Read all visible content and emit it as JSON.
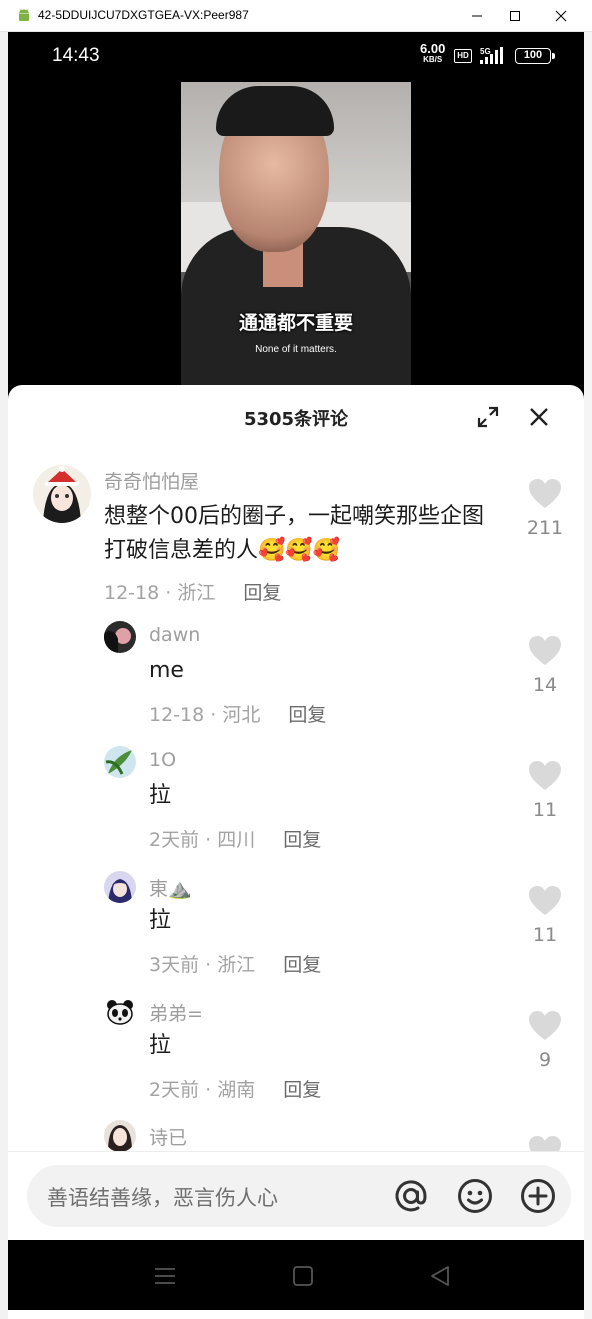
{
  "window": {
    "title": "42-5DDUIJCU7DXGTGEA-VX:Peer987"
  },
  "status": {
    "time": "14:43",
    "speed_value": "6.00",
    "speed_unit": "KB/S",
    "hd": "HD",
    "network": "5G",
    "battery": "100"
  },
  "video": {
    "subtitle_zh": "通通都不重要",
    "subtitle_en": "None of it matters."
  },
  "comments_panel": {
    "title": "5305条评论",
    "comments": [
      {
        "user": "奇奇怕怕屋",
        "text": "想整个00后的圈子，一起嘲笑那些企图打破信息差的人🥰🥰🥰",
        "date": "12-18 · 浙江",
        "reply": "回复",
        "likes": "211"
      },
      {
        "user": "dawn",
        "text": "me",
        "date": "12-18 · 河北",
        "reply": "回复",
        "likes": "14"
      },
      {
        "user": "1O",
        "text": "拉",
        "date": "2天前 · 四川",
        "reply": "回复",
        "likes": "11"
      },
      {
        "user": "東⛰️",
        "text": "拉",
        "date": "3天前 · 浙江",
        "reply": "回复",
        "likes": "11"
      },
      {
        "user": "弟弟=",
        "text": "拉",
        "date": "2天前 · 湖南",
        "reply": "回复",
        "likes": "9"
      },
      {
        "user": "诗已",
        "text": "",
        "date": "",
        "reply": "",
        "likes": ""
      }
    ]
  },
  "input": {
    "placeholder": "善语结善缘，恶言伤人心"
  },
  "icons": {
    "mention": "at-icon",
    "emoji": "emoji-icon",
    "add": "plus-icon",
    "like": "heart-icon"
  }
}
